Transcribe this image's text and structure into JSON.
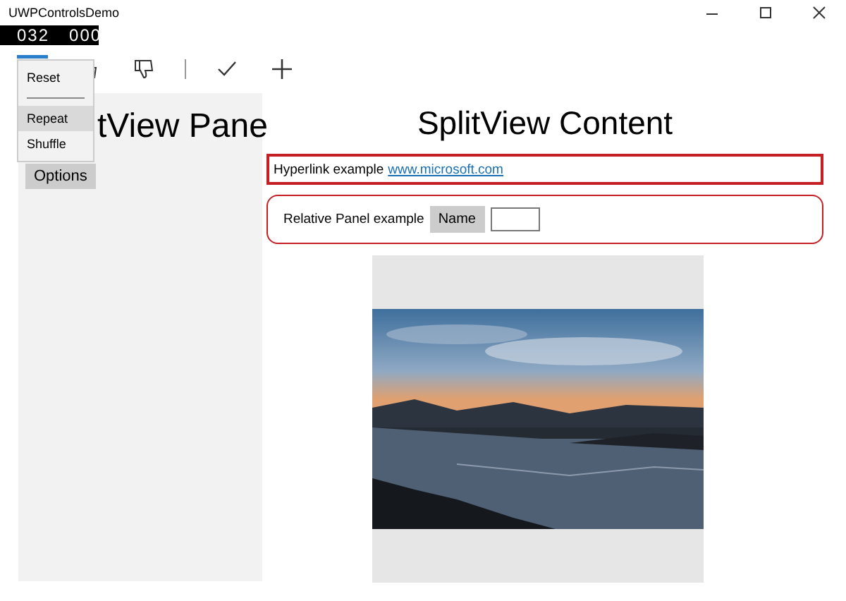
{
  "window": {
    "title": "UWPControlsDemo"
  },
  "counter": [
    "032",
    "000"
  ],
  "menu": [
    {
      "kind": "item",
      "label": "Reset",
      "selected": false
    },
    {
      "kind": "separator"
    },
    {
      "kind": "item",
      "label": "Repeat",
      "selected": true
    },
    {
      "kind": "item",
      "label": "Shuffle",
      "selected": false
    }
  ],
  "pane": {
    "title": "tView Pane",
    "button": "Options"
  },
  "content": {
    "title": "SplitView Content",
    "hyperlink": {
      "label": "Hyperlink example",
      "link": "www.microsoft.com"
    },
    "relative_panel": {
      "label": "Relative Panel example",
      "button": "Name"
    }
  }
}
